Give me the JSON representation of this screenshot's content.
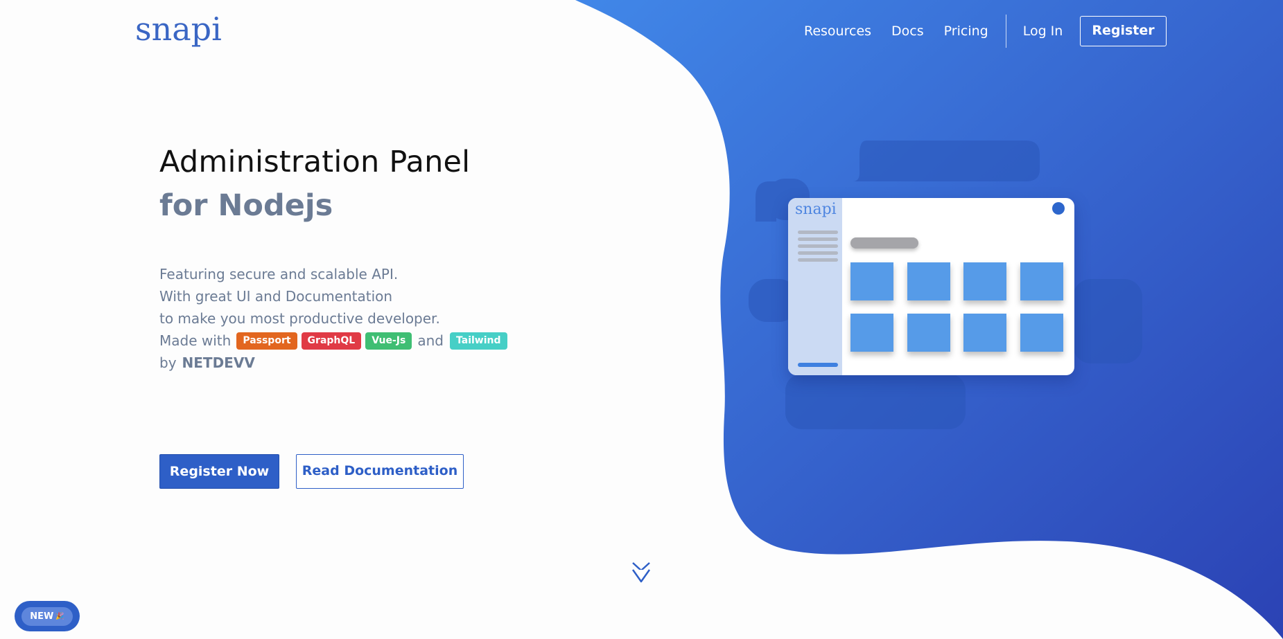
{
  "brand": {
    "logo_text": "snapi"
  },
  "nav": {
    "links": [
      "Resources",
      "Docs",
      "Pricing"
    ],
    "login_label": "Log In",
    "register_label": "Register"
  },
  "hero": {
    "title": "Administration Panel",
    "subtitle": "for Nodejs"
  },
  "description": {
    "line1": "Featuring secure and scalable API.",
    "line2": "With great UI and Documentation",
    "line3": "to make you most productive developer.",
    "made_with": "Made with",
    "and": "and",
    "by": "by",
    "author": "NETDEVV",
    "badges": {
      "passport": "Passport",
      "graphql": "GraphQL",
      "vue": "Vue-Js",
      "tailwind": "Tailwind"
    }
  },
  "cta": {
    "primary_label": "Register Now",
    "secondary_label": "Read Documentation"
  },
  "new_pill": {
    "label": "NEW",
    "emoji": "🎉"
  },
  "mock_app": {
    "logo_text": "snapi"
  },
  "colors": {
    "brand": "#2e5fc7",
    "gradient_top": "#4187e8",
    "gradient_bottom": "#2b42b4",
    "badge_passport": "#e2661f",
    "badge_graphql": "#e03a45",
    "badge_vue": "#3fbe73",
    "badge_tailwind": "#46cfc6"
  },
  "icons": {
    "scroll_down": "chevron-double-down-icon"
  }
}
